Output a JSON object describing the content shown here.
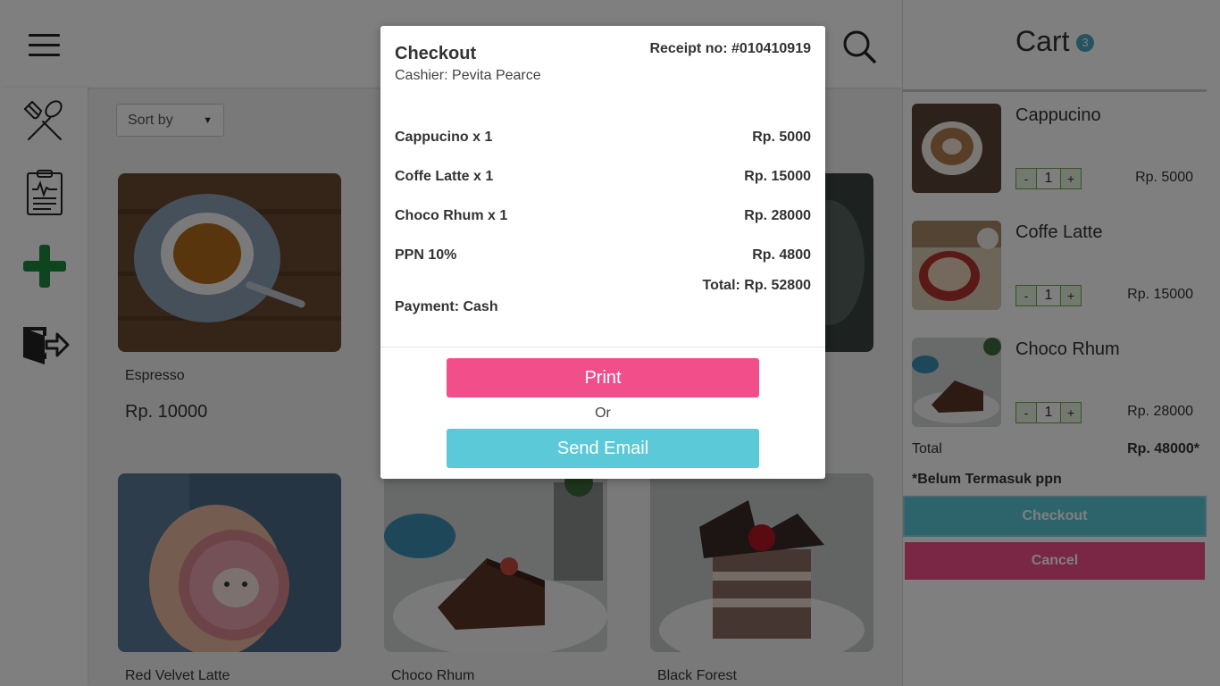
{
  "header": {
    "search_icon": "search-icon",
    "menu_icon": "hamburger-icon"
  },
  "sidebar": {
    "icons": [
      "fork-spoon-icon",
      "clipboard-icon",
      "plus-icon",
      "logout-icon"
    ]
  },
  "main": {
    "sort_label": "Sort by",
    "products": [
      {
        "name": "Espresso",
        "price": "Rp. 10000"
      },
      {
        "name": "Red Velvet Latte"
      },
      {
        "name": "Choco Rhum"
      },
      {
        "name": "Black Forest"
      }
    ]
  },
  "cart": {
    "title": "Cart",
    "count": "3",
    "items": [
      {
        "name": "Cappucino",
        "qty": "1",
        "price": "Rp. 5000"
      },
      {
        "name": "Coffe Latte",
        "qty": "1",
        "price": "Rp. 15000"
      },
      {
        "name": "Choco Rhum",
        "qty": "1",
        "price": "Rp. 28000"
      }
    ],
    "minus": "-",
    "plus": "+",
    "total_label": "Total",
    "total_value": "Rp. 48000*",
    "note": "*Belum Termasuk ppn",
    "checkout_label": "Checkout",
    "cancel_label": "Cancel"
  },
  "modal": {
    "title": "Checkout",
    "cashier": "Cashier: Pevita Pearce",
    "receipt": "Receipt no: #010410919",
    "lines": [
      {
        "label": "Cappucino x 1",
        "amount": "Rp. 5000"
      },
      {
        "label": "Coffe Latte x 1",
        "amount": "Rp. 15000"
      },
      {
        "label": "Choco Rhum x 1",
        "amount": "Rp. 28000"
      },
      {
        "label": "PPN 10%",
        "amount": "Rp. 4800"
      }
    ],
    "total": "Total: Rp. 52800",
    "payment": "Payment: Cash",
    "print_label": "Print",
    "or_label": "Or",
    "email_label": "Send Email"
  },
  "colors": {
    "accent_pink": "#f24f8a",
    "accent_teal": "#5bc9d7",
    "badge": "#4aa7be",
    "plus_green": "#1e8a3c"
  }
}
